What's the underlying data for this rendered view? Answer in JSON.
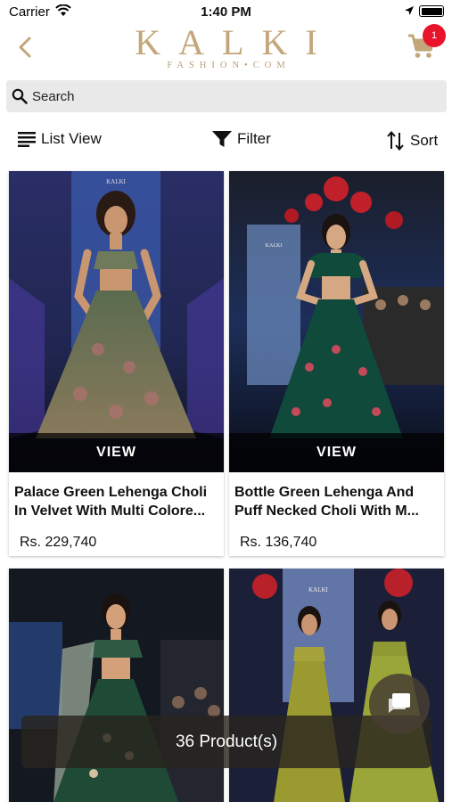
{
  "status_bar": {
    "carrier": "Carrier",
    "time": "1:40 PM"
  },
  "header": {
    "logo_main": "KALKI",
    "logo_sub": "FASHION•COM",
    "cart_count": "1"
  },
  "search": {
    "placeholder": "Search"
  },
  "toolbar": {
    "list_view": "List View",
    "filter": "Filter",
    "sort": "Sort"
  },
  "products": [
    {
      "title_line1": "Palace Green Lehenga Choli",
      "title_line2": "In Velvet With Multi Colore...",
      "price": "Rs. 229,740",
      "view_label": "VIEW",
      "image_logo": "KALKI"
    },
    {
      "title_line1": "Bottle Green Lehenga And",
      "title_line2": "Puff Necked Choli With M...",
      "price": "Rs. 136,740",
      "view_label": "VIEW",
      "image_logo": "KALKI"
    },
    {
      "image_logo": ""
    },
    {
      "image_logo": "KALKI"
    }
  ],
  "product_count": "36 Product(s)",
  "colors": {
    "brand_gold": "#c3a679",
    "badge_red": "#e8142b",
    "search_bg": "#e9e9e9"
  }
}
